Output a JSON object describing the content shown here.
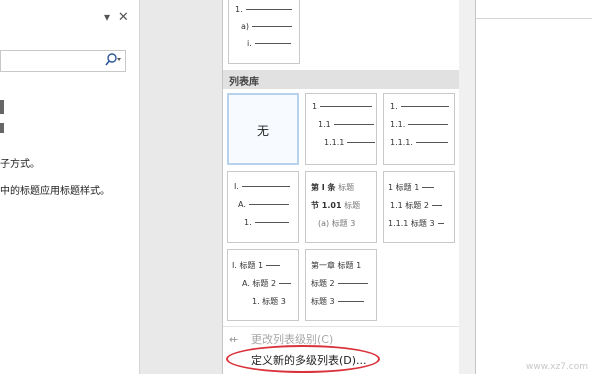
{
  "nav": {
    "close": "✕",
    "dropdown": "▾",
    "search_icon": "⚲",
    "search_caret": "▾",
    "text_1": "子方式。",
    "text_2": "中的标题应用标题样式。"
  },
  "gallery": {
    "section_label": "列表库",
    "top_thumb": {
      "r1": "1.",
      "r2": "a)",
      "r3": "i."
    },
    "none_label": "无",
    "t2": {
      "r1": "1",
      "r2": "1.1",
      "r3": "1.1.1"
    },
    "t3": {
      "r1": "1.",
      "r2": "1.1.",
      "r3": "1.1.1."
    },
    "t4": {
      "r1": "I.",
      "r2": "A.",
      "r3": "1."
    },
    "t5": {
      "r1a": "第 I 条",
      "r1b": "标题",
      "r2a": "节 1.01",
      "r2b": "标题",
      "r3a": "(a) 标题",
      "r3b": "3"
    },
    "t6": {
      "r1a": "1 标题",
      "r1b": "1",
      "r2a": "1.1 标题",
      "r2b": "2",
      "r3a": "1.1.1 标题",
      "r3b": "3"
    },
    "t7": {
      "r1": "I. 标题 1",
      "r2": "A. 标题 2",
      "r3": "1. 标题 3"
    },
    "t8": {
      "r1": "第一章 标题 1",
      "r2": "标题 2",
      "r3": "标题 3"
    }
  },
  "menu": {
    "change_level": "更改列表级别(C)",
    "define_new": "定义新的多级列表(D)..."
  },
  "watermark": "www.xz7.com"
}
